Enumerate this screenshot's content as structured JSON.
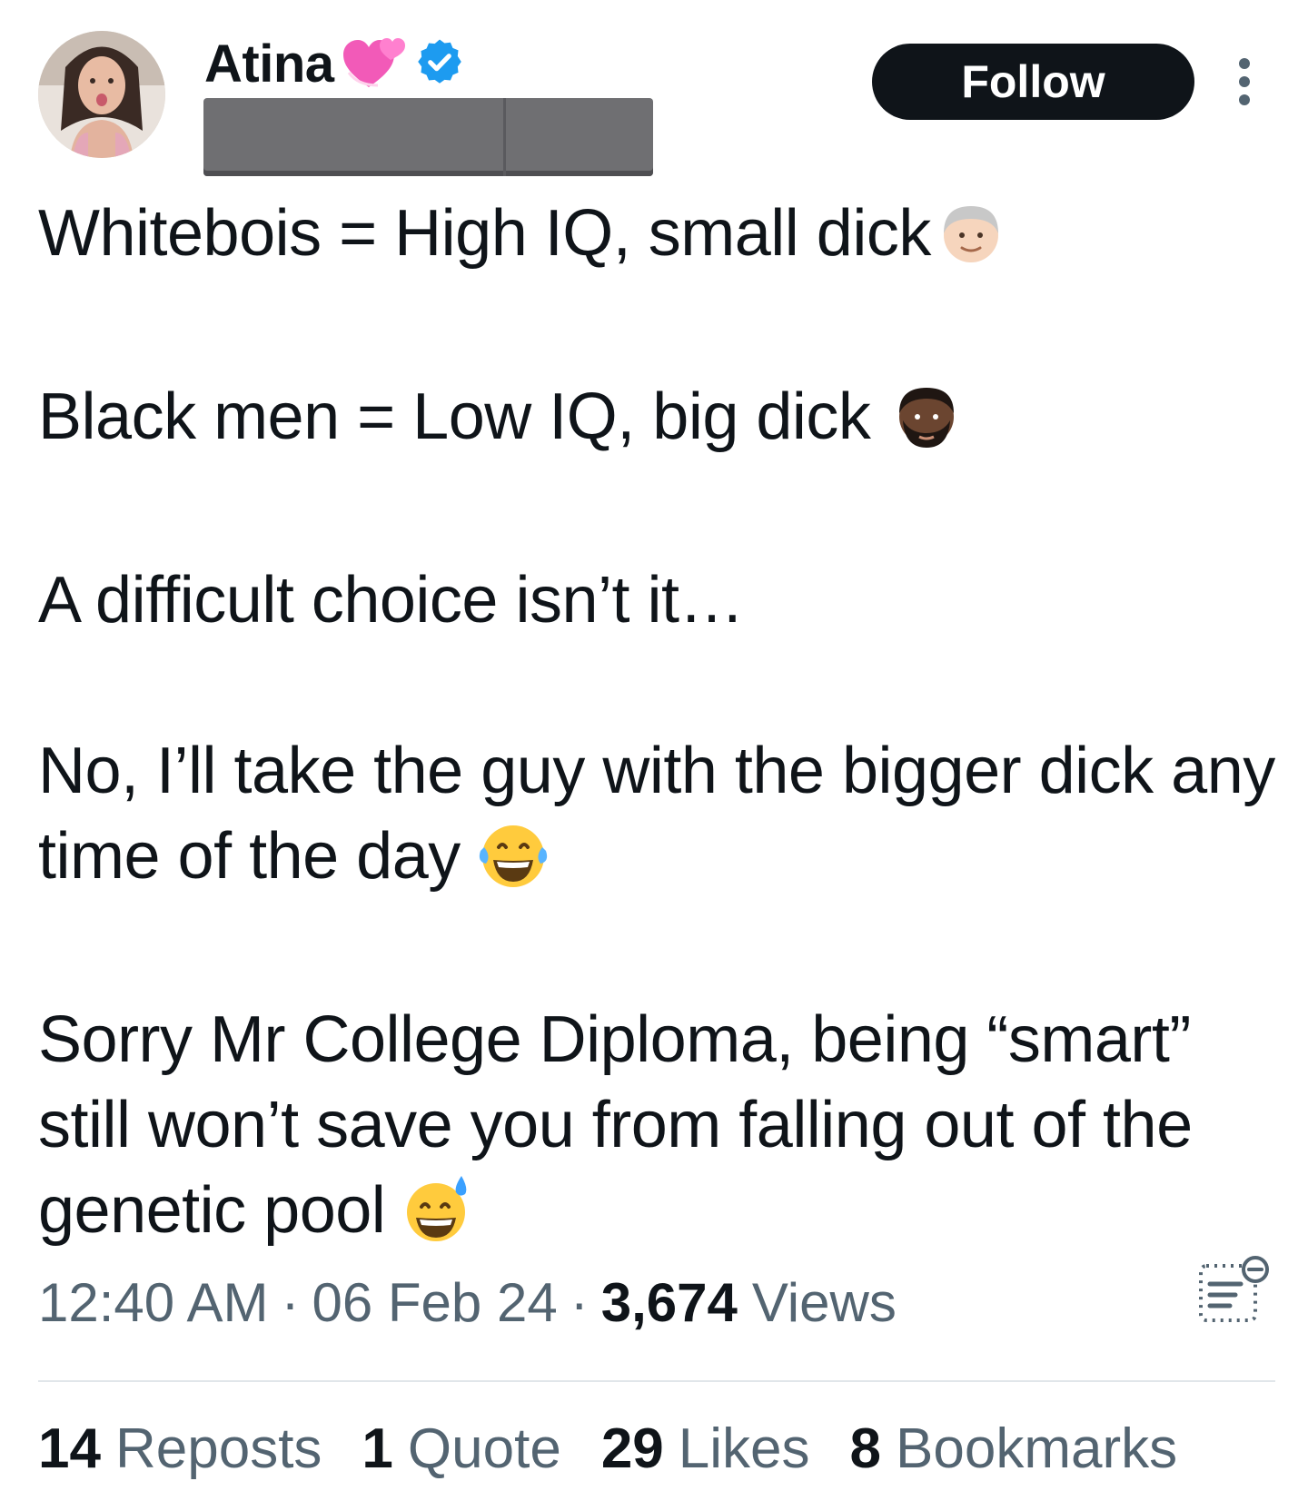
{
  "user": {
    "display_name": "Atina",
    "name_emoji_icon": "two-hearts-icon",
    "verified_icon": "verified-badge-icon"
  },
  "header": {
    "follow_label": "Follow",
    "more_icon": "more-options-icon"
  },
  "tweet": {
    "paragraphs": [
      "Whitebois = High IQ, small dick",
      "Black men = Low IQ, big dick",
      "A difficult choice isn’t it…",
      "No, I’ll take the guy with the bigger dick any time of the day",
      "Sorry Mr College Diploma, being “smart” still won’t save you from falling out of the genetic pool"
    ],
    "emojis": [
      "older-man-emoji",
      "bearded-man-emoji",
      "tears-of-joy-emoji",
      "grinning-sweat-emoji"
    ]
  },
  "meta": {
    "time": "12:40 AM",
    "date": "06 Feb 24",
    "views_count": "3,674",
    "views_label": "Views",
    "separator": "·"
  },
  "stats": {
    "reposts_count": "14",
    "reposts_label": "Reposts",
    "quotes_count": "1",
    "quotes_label": "Quote",
    "likes_count": "29",
    "likes_label": "Likes",
    "bookmarks_count": "8",
    "bookmarks_label": "Bookmarks"
  },
  "colors": {
    "text_primary": "#0f1419",
    "text_secondary": "#536471",
    "verified_blue": "#1d9bf0",
    "follow_bg": "#0f1419",
    "divider": "#e1e6ea"
  }
}
